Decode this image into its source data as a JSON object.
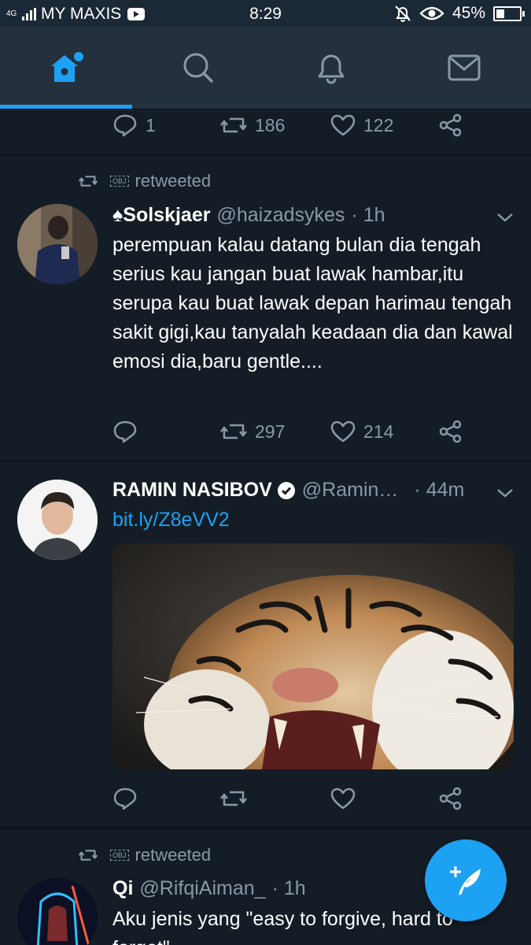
{
  "status_bar": {
    "network_type": "4G",
    "carrier": "MY MAXIS",
    "time": "8:29",
    "battery": "45%"
  },
  "nav": {
    "tabs": [
      {
        "icon": "home-icon",
        "active": true
      },
      {
        "icon": "search-icon",
        "active": false
      },
      {
        "icon": "bell-icon",
        "active": false
      },
      {
        "icon": "mail-icon",
        "active": false
      }
    ],
    "accent_color": "#1da1f2"
  },
  "tweets": [
    {
      "replies": "1",
      "retweets": "186",
      "likes": "122"
    },
    {
      "retweeted_label": "retweeted",
      "retweeter_placeholder": "OBJ",
      "name": "♠Solskjaer",
      "handle": "@haizadsykes",
      "time": "· 1h",
      "text": "perempuan kalau datang bulan dia tengah serius kau jangan buat lawak hambar,itu serupa kau buat lawak depan harimau tengah sakit gigi,kau tanyalah keadaan dia dan kawal emosi dia,baru gentle....",
      "replies": "",
      "retweets": "297",
      "likes": "214"
    },
    {
      "name": "RAMIN NASIBOV",
      "verified": true,
      "handle": "@Ramin…",
      "time": "· 44m",
      "link": "bit.ly/Z8eVV2",
      "media": "tiger-photo",
      "replies": "",
      "retweets": "",
      "likes": ""
    },
    {
      "retweeted_label": "retweeted",
      "retweeter_placeholder": "OBJ",
      "name": "Qi",
      "handle": "@RifqiAiman_",
      "time": "· 1h",
      "text": "Aku jenis yang \"easy to forgive, hard to forget\""
    }
  ],
  "fab": {
    "icon": "compose-tweet-icon"
  }
}
